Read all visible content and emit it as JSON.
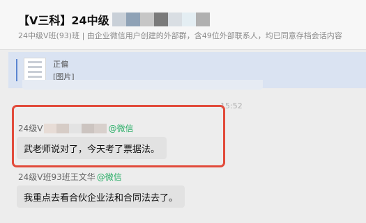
{
  "header": {
    "title": "【V三科】24中级",
    "subtitle": "24中级V班(93)班 | 由企业微信用户创建的外部群，含49位外部联系人，均已同意存档会话内容",
    "title_mosaic_colors": [
      "#c9d0d8",
      "#8fa2b6",
      "#c6c6c6",
      "#7a7a7a",
      "#d9dee3",
      "#e4eef3",
      "#b0b0b0"
    ]
  },
  "quoted_message": {
    "line1": "正偏",
    "line2": "[图片]",
    "accent_color": "#5b85d0"
  },
  "chat": {
    "timestamp": "15:52",
    "highlight_color": "#e24b3b",
    "messages": [
      {
        "sender": "24级V",
        "sender_tag": "@微信",
        "sender_mosaic_colors": [
          "#e7dcd6",
          "#d6ccc6",
          "#e3e3e3",
          "#ccc4c0",
          "#d8d0cc"
        ],
        "text": "武老师说对了，今天考了票据法。"
      },
      {
        "sender": "24级V班93班王文华",
        "sender_tag": "@微信",
        "text": "我重点去看合伙企业法和合同法去了。"
      }
    ]
  },
  "icons": {
    "document_thumbnail": "document-icon"
  }
}
